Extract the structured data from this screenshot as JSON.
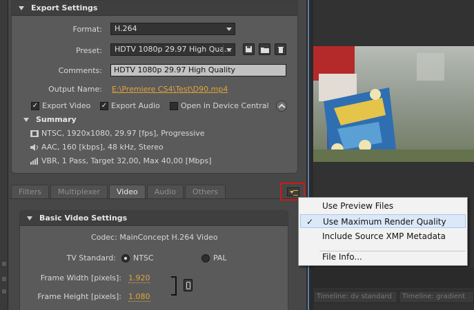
{
  "export_settings": {
    "title": "Export Settings",
    "format_label": "Format:",
    "format_value": "H.264",
    "preset_label": "Preset:",
    "preset_value": "HDTV 1080p 29.97 High Qua...",
    "comments_label": "Comments:",
    "comments_value": "HDTV 1080p 29.97 High Quality",
    "output_label": "Output Name:",
    "output_value": "E:\\Premiere CS4\\Test\\D90.mp4",
    "export_video": "Export Video",
    "export_audio": "Export Audio",
    "open_device_central": "Open in Device Central",
    "summary_title": "Summary",
    "summary_video": "NTSC, 1920x1080, 29.97 [fps], Progressive",
    "summary_audio": "AAC, 160 [kbps], 48 kHz, Stereo",
    "summary_bitrate": "VBR, 1 Pass, Target 32,00, Max 40,00 [Mbps]"
  },
  "tabs": [
    "Filters",
    "Multiplexer",
    "Video",
    "Audio",
    "Others"
  ],
  "active_tab": "Video",
  "basic_video": {
    "title": "Basic Video Settings",
    "codec": "Codec:  MainConcept H.264 Video",
    "tv_standard_label": "TV Standard:",
    "ntsc": "NTSC",
    "pal": "PAL",
    "frame_width_label": "Frame Width [pixels]:",
    "frame_width_value": "1.920",
    "frame_height_label": "Frame Height [pixels]:",
    "frame_height_value": "1.080"
  },
  "menu": {
    "items": [
      "Use Preview Files",
      "Use Maximum Render Quality",
      "Include Source XMP Metadata",
      "File Info..."
    ],
    "checked_item": "Use Maximum Render Quality",
    "check_glyph": "✓"
  },
  "timeline": {
    "tab1": "Timeline: dv standard",
    "tab2": "Timeline: gradient"
  },
  "colors": {
    "link": "#e2a43c",
    "highlight_box": "#d11818",
    "menu_hover": "#dbe8f7"
  }
}
